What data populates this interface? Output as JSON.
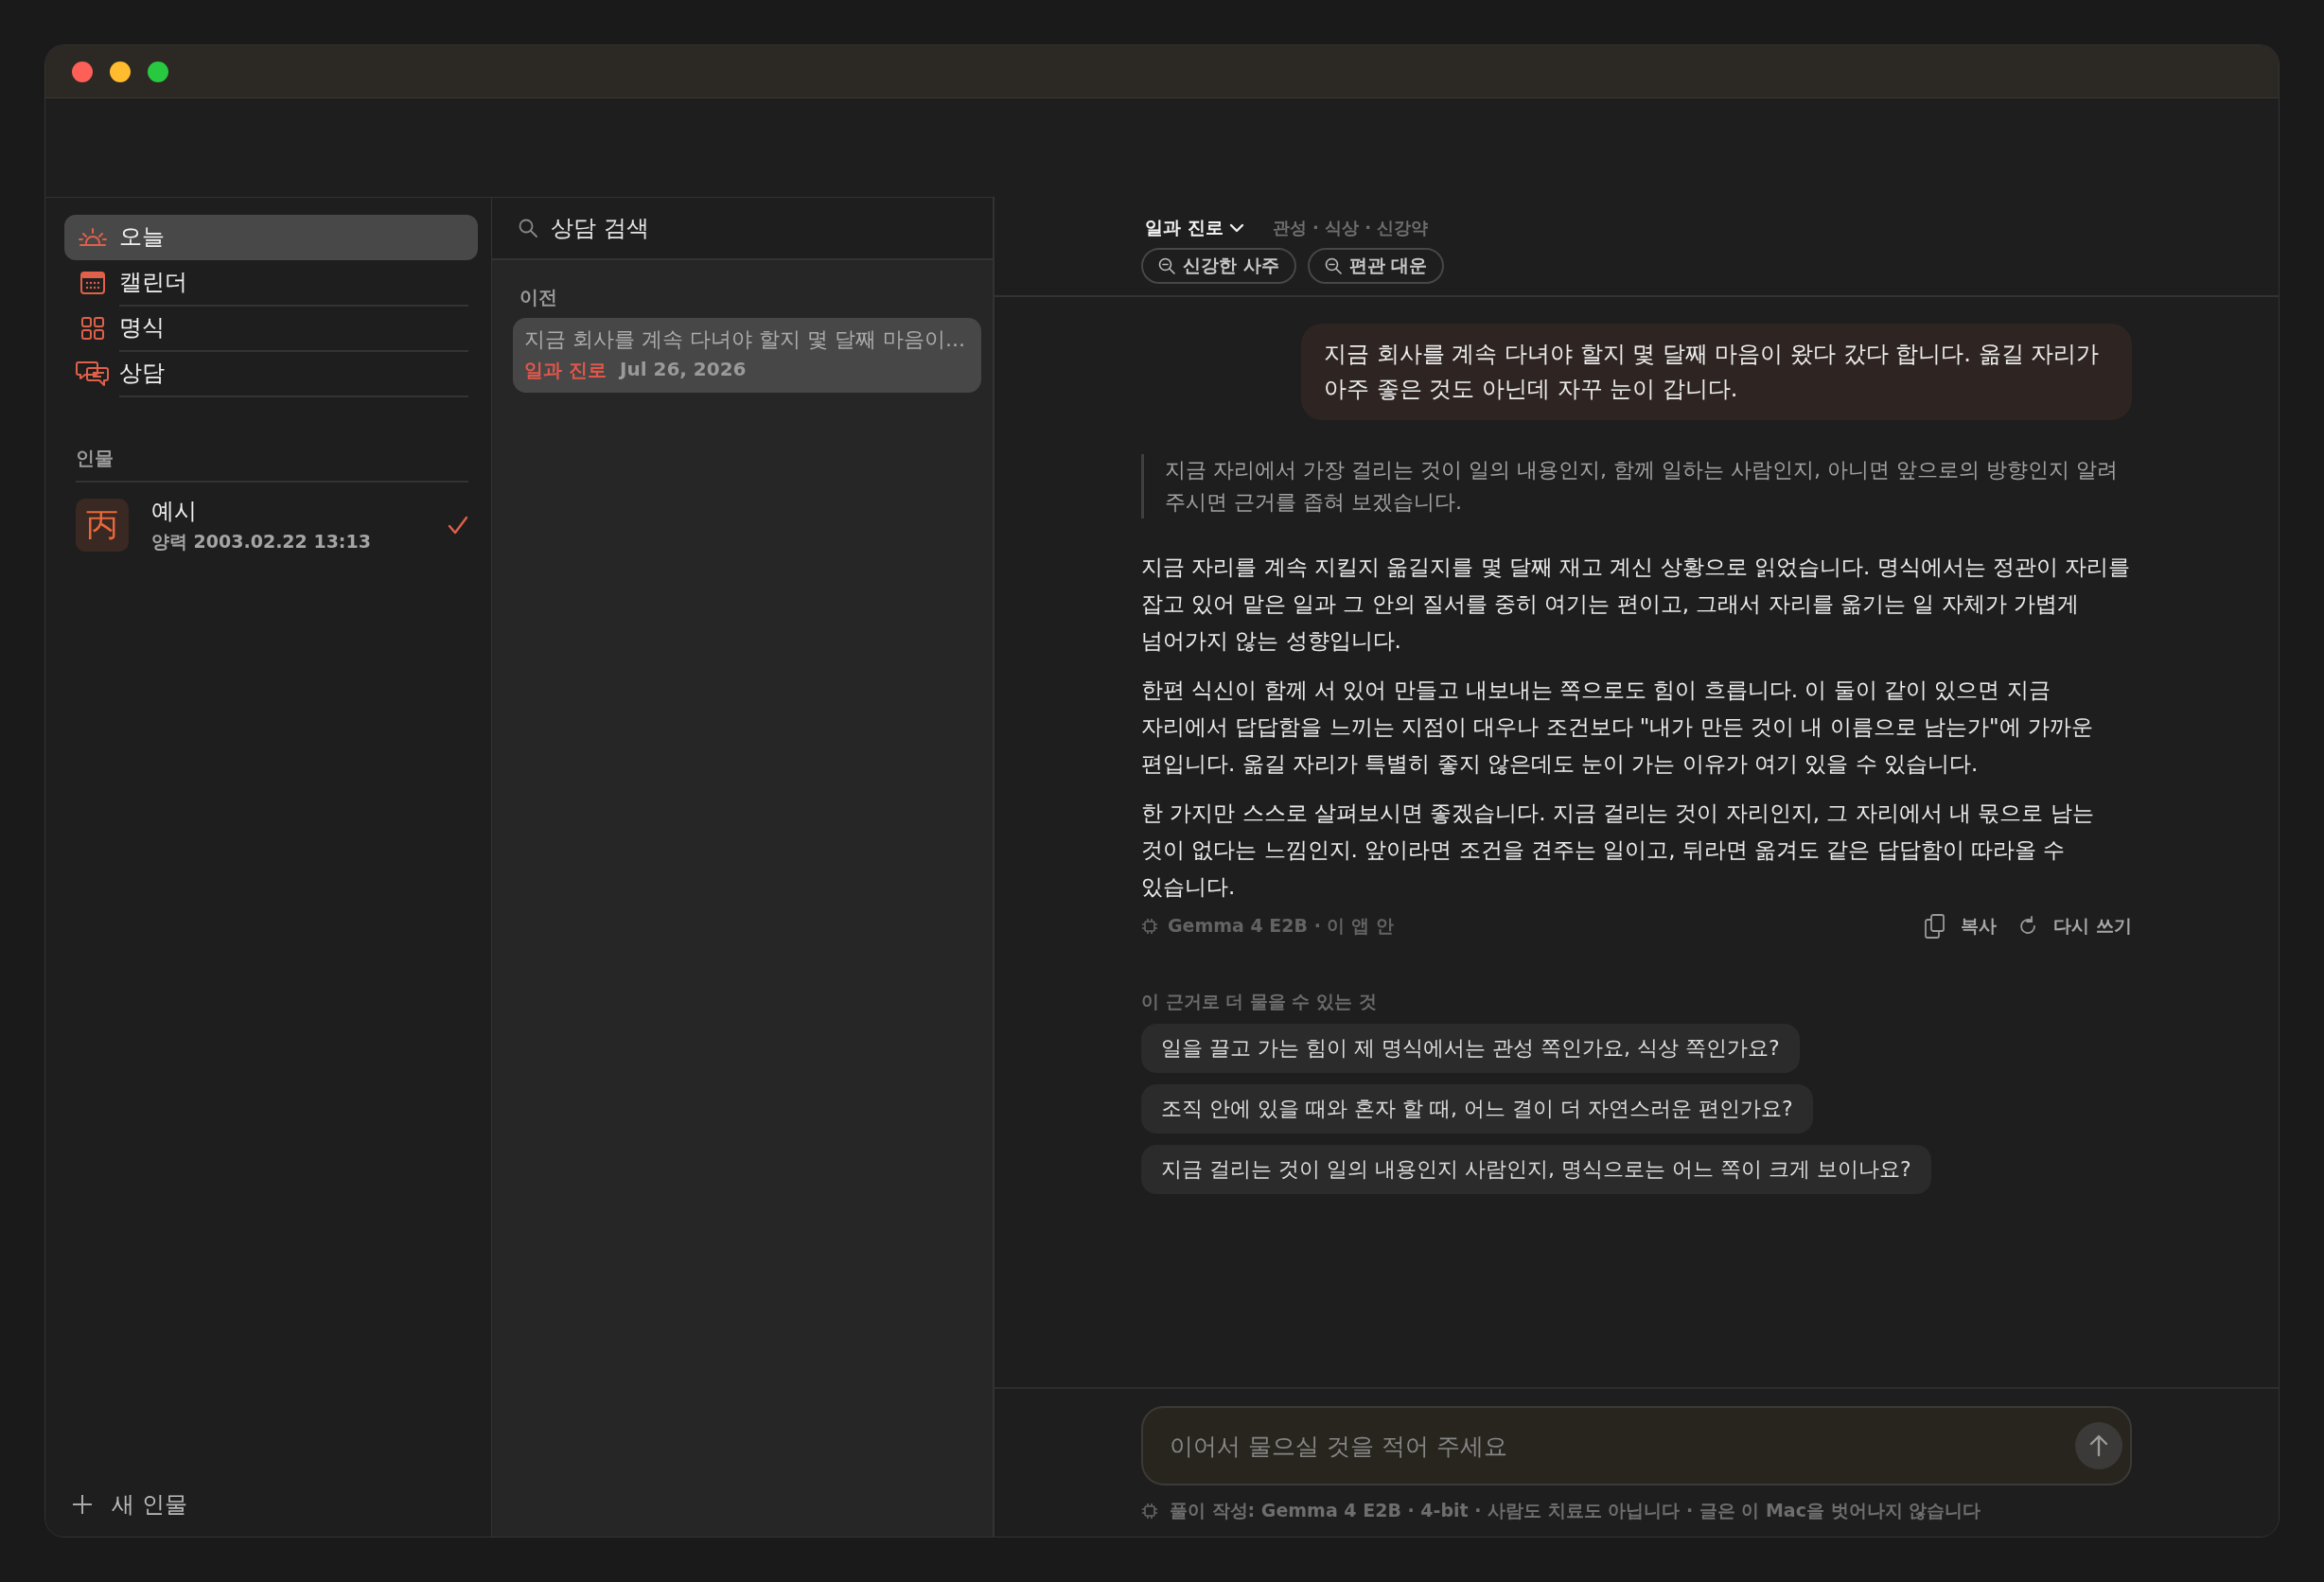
{
  "sidebar": {
    "items": [
      {
        "kind": "sun",
        "label": "오늘",
        "selected": true
      },
      {
        "kind": "calendar",
        "label": "캘린더",
        "selected": false
      },
      {
        "kind": "grid",
        "label": "명식",
        "selected": false
      },
      {
        "kind": "chat",
        "label": "상담",
        "selected": false
      }
    ],
    "section_title": "인물",
    "people": [
      {
        "avatar": "丙",
        "name": "예시",
        "detail": "양력 2003.02.22 13:13",
        "checked": true
      }
    ],
    "add_button": "새 인물"
  },
  "consult_list": {
    "search_placeholder": "상담 검색",
    "section_title": "이전",
    "items": [
      {
        "title": "지금 회사를 계속 다녀야 할지 몇 달째 마음이...",
        "tag": "일과 진로",
        "date": "Jul 26, 2026",
        "selected": true
      }
    ]
  },
  "chat": {
    "topic": "일과 진로",
    "topic_hint": "관성 · 식상 · 신강약",
    "chips": [
      "신강한 사주",
      "편관 대운"
    ],
    "messages": [
      {
        "kind": "user",
        "text": "지금 회사를 계속 다녀야 할지 몇 달째 마음이 왔다 갔다 합니다. 옮길 자리가 아주 좋은 것도 아닌데 자꾸 눈이 갑니다."
      },
      {
        "kind": "quote",
        "text": "지금 자리에서 가장 걸리는 것이 일의 내용인지, 함께 일하는 사람인지, 아니면 앞으로의 방향인지 알려 주시면 근거를 좁혀 보겠습니다."
      },
      {
        "kind": "answer",
        "paragraphs": [
          "지금 자리를 계속 지킬지 옮길지를 몇 달째 재고 계신 상황으로 읽었습니다. 명식에서는 정관이 자리를 잡고 있어 맡은 일과 그 안의 질서를 중히 여기는 편이고, 그래서 자리를 옮기는 일 자체가 가볍게 넘어가지 않는 성향입니다.",
          "한편 식신이 함께 서 있어 만들고 내보내는 쪽으로도 힘이 흐릅니다. 이 둘이 같이 있으면 지금 자리에서 답답함을 느끼는 지점이 대우나 조건보다 \"내가 만든 것이 내 이름으로 남는가\"에 가까운 편입니다. 옮길 자리가 특별히 좋지 않은데도 눈이 가는 이유가 여기 있을 수 있습니다.",
          "한 가지만 스스로 살펴보시면 좋겠습니다. 지금 걸리는 것이 자리인지, 그 자리에서 내 몫으로 남는 것이 없다는 느낌인지. 앞이라면 조건을 견주는 일이고, 뒤라면 옮겨도 같은 답답함이 따라올 수 있습니다."
        ],
        "model": "Gemma 4 E2B · 이 앱 안",
        "actions": [
          {
            "kind": "copy",
            "label": "복사"
          },
          {
            "kind": "redo",
            "label": "다시 쓰기"
          }
        ]
      }
    ],
    "suggestions_title": "이 근거로 더 물을 수 있는 것",
    "suggestions": [
      "일을 끌고 가는 힘이 제 명식에서는 관성 쪽인가요, 식상 쪽인가요?",
      "조직 안에 있을 때와 혼자 할 때, 어느 결이 더 자연스러운 편인가요?",
      "지금 걸리는 것이 일의 내용인지 사람인지, 명식으로는 어느 쪽이 크게 보이나요?"
    ],
    "input_placeholder": "이어서 물으실 것을 적어 주세요",
    "footer": "풀이 작성: Gemma 4 E2B · 4-bit · 사람도 치료도 아닙니다 · 글은 이 Mac을 벗어나지 않습니다"
  }
}
